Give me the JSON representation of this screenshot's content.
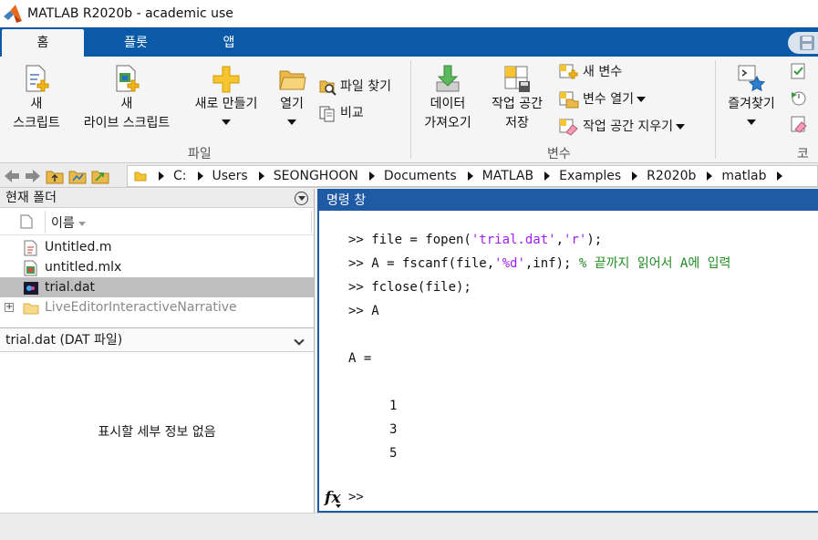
{
  "window": {
    "title": "MATLAB R2020b - academic use"
  },
  "tabs": [
    {
      "label": "홈"
    },
    {
      "label": "플롯"
    },
    {
      "label": "앱"
    }
  ],
  "ribbon": {
    "new_script": {
      "line1": "새",
      "line2": "스크립트"
    },
    "new_live_script": {
      "line1": "새",
      "line2": "라이브 스크립트"
    },
    "new": {
      "label": "새로 만들기"
    },
    "open": {
      "label": "열기"
    },
    "find_files": {
      "label": "파일 찾기"
    },
    "compare": {
      "label": "비교"
    },
    "file_section": "파일",
    "import_data": {
      "line1": "데이터",
      "line2": "가져오기"
    },
    "save_workspace": {
      "line1": "작업 공간",
      "line2": "저장"
    },
    "new_variable": {
      "label": "새 변수"
    },
    "open_variable": {
      "label": "변수 열기"
    },
    "clear_workspace": {
      "label": "작업 공간 지우기"
    },
    "variable_section": "변수",
    "favorites": {
      "label": "즐겨찾기"
    },
    "code_section": "코드"
  },
  "address": {
    "segments": [
      "C:",
      "Users",
      "SEONGHOON",
      "Documents",
      "MATLAB",
      "Examples",
      "R2020b",
      "matlab"
    ]
  },
  "current_folder": {
    "title": "현재 폴더",
    "column_name": "이름",
    "files": [
      {
        "name": "Untitled.m",
        "icon": "m-file-icon"
      },
      {
        "name": "untitled.mlx",
        "icon": "mlx-file-icon"
      },
      {
        "name": "trial.dat",
        "icon": "dat-file-icon"
      },
      {
        "name": "LiveEditorInteractiveNarrative",
        "icon": "folder-icon"
      }
    ],
    "details_header": "trial.dat  (DAT 파일)",
    "no_details": "표시할 세부 정보 없음"
  },
  "command_window": {
    "title": "명령 창",
    "line1": {
      "p": ">> file = fopen(",
      "s1": "'trial.dat'",
      "c": ",",
      "s2": "'r'",
      "e": ");"
    },
    "line2": {
      "p": ">> A = fscanf(file,",
      "s": "'%d'",
      "e": ",inf); ",
      "cmt": "% 끝까지 읽어서 A에 입력"
    },
    "line3": ">> fclose(file);",
    "line4": ">> A",
    "line5": "",
    "line6": "A =",
    "line7": "",
    "values": [
      "1",
      "3",
      "5"
    ],
    "fx_label": "fx",
    "prompt": ">>"
  },
  "colors": {
    "tab_strip": "#0b5aa8",
    "command_header": "#1f5aa5",
    "string": "#a020f0",
    "comment": "#228b22"
  }
}
